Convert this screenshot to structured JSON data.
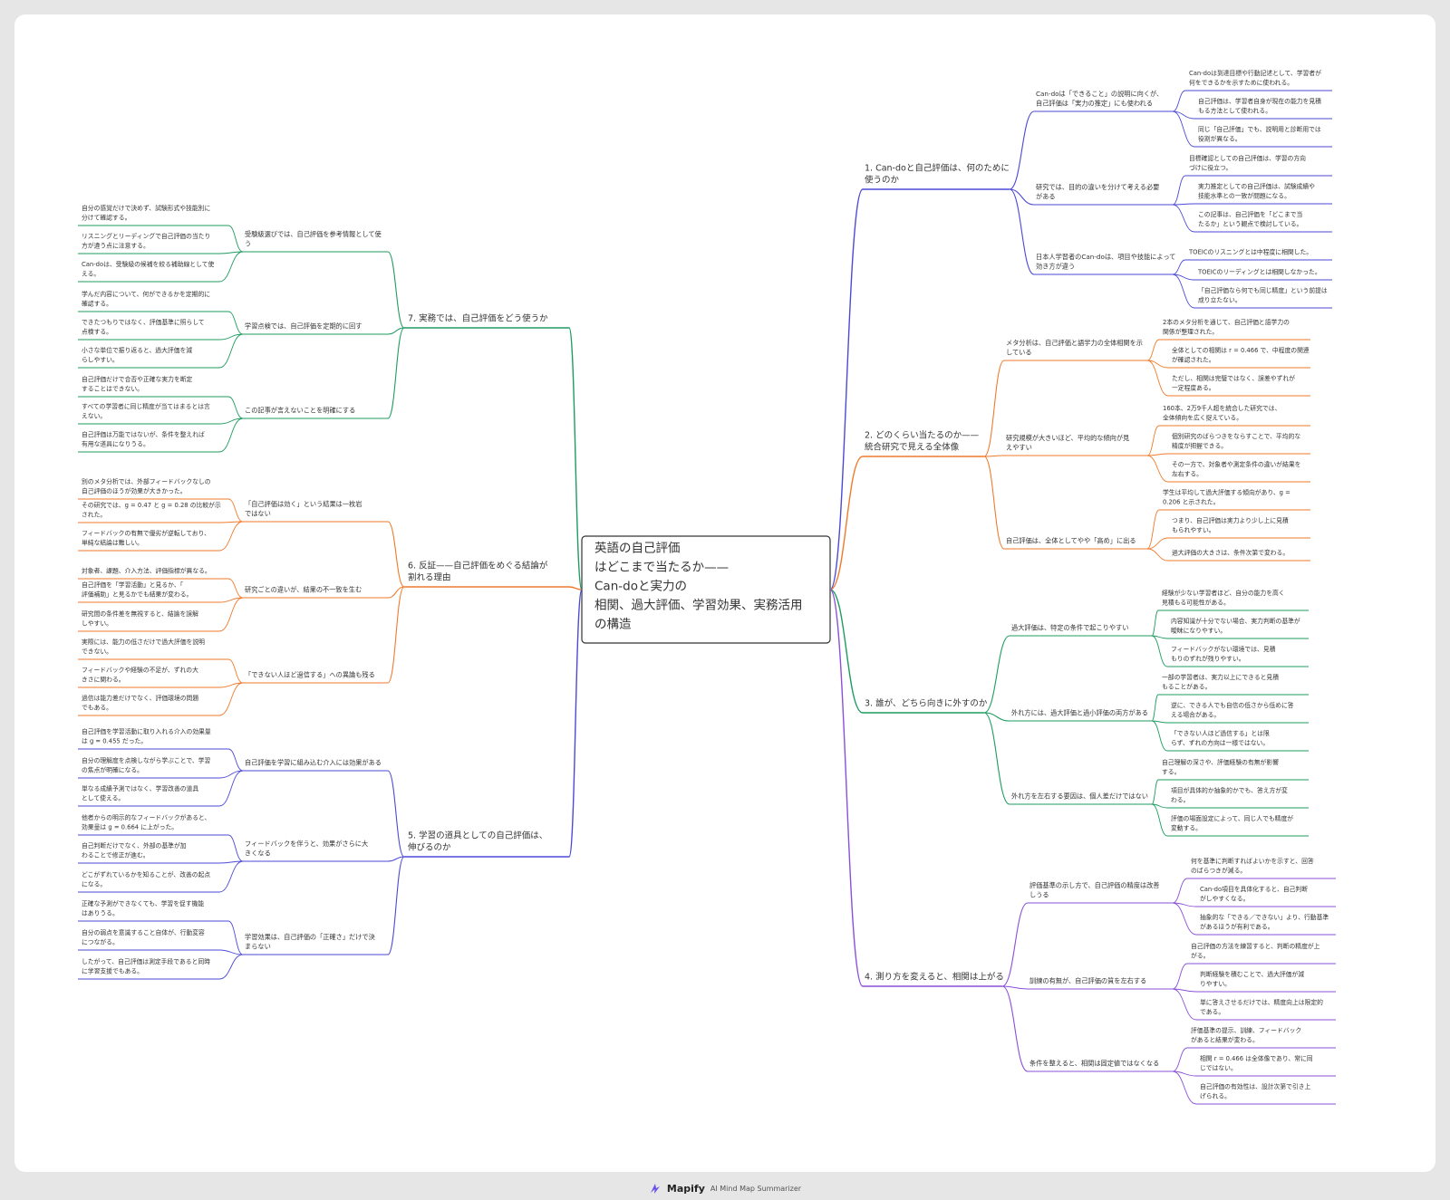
{
  "root": {
    "lines": [
      "英語の自己評価",
      "はどこまで当たるか——",
      "Can-doと実力の",
      "相関、過大評価、学習効果、実務活用",
      "の構造"
    ]
  },
  "footer": {
    "brand": "Mapify",
    "tagline": "AI Mind Map Summarizer"
  },
  "colors": {
    "blue": "#4b49d6",
    "orange": "#f07a2b",
    "green": "#1e9c5f",
    "purple": "#8b4fd8",
    "node_text": "#333333"
  },
  "icons": {
    "footer_logo": "mapify-logo-icon"
  },
  "branches": [
    {
      "id": "b1",
      "side": "right",
      "color": "blue",
      "label": [
        "1. Can-doと自己評価は、何のために",
        "使うのか"
      ],
      "children": [
        {
          "label": [
            "Can-doは「できること」の説明に向くが、",
            "自己評価は「実力の推定」にも使われる"
          ],
          "leaves": [
            [
              "Can-doは到達目標や行動記述として、学習者が",
              "何をできるかを示すために使われる。"
            ],
            [
              "自己評価は、学習者自身が現在の能力を見積",
              "もる方法として使われる。"
            ],
            [
              "同じ「自己評価」でも、説明用と診断用では",
              "役割が異なる。"
            ]
          ]
        },
        {
          "label": [
            "研究では、目的の違いを分けて考える必要",
            "がある"
          ],
          "leaves": [
            [
              "目標確認としての自己評価は、学習の方向",
              "づけに役立つ。"
            ],
            [
              "実力推定としての自己評価は、試験成績や",
              "技能水準との一致が問題になる。"
            ],
            [
              "この記事は、自己評価を「どこまで当",
              "たるか」という観点で検討している。"
            ]
          ]
        },
        {
          "label": [
            "日本人学習者のCan-doは、項目や技能によって",
            "効き方が違う"
          ],
          "leaves": [
            [
              "TOEICのリスニングとは中程度に相関した。"
            ],
            [
              "TOEICのリーディングとは相関しなかった。"
            ],
            [
              "「自己評価なら何でも同じ精度」という前提は",
              "成り立たない。"
            ]
          ]
        }
      ]
    },
    {
      "id": "b2",
      "side": "right",
      "color": "orange",
      "label": [
        "2. どのくらい当たるのか——",
        "統合研究で見える全体像"
      ],
      "children": [
        {
          "label": [
            "メタ分析は、自己評価と語学力の全体相関を示",
            "している"
          ],
          "leaves": [
            [
              "2本のメタ分析を通じて、自己評価と語学力の",
              "関係が整理された。"
            ],
            [
              "全体としての相関は r = 0.466 で、中程度の関連",
              "が確認された。"
            ],
            [
              "ただし、相関は完璧ではなく、誤差やずれが",
              "一定程度ある。"
            ]
          ]
        },
        {
          "label": [
            "研究規模が大きいほど、平均的な傾向が見",
            "えやすい"
          ],
          "leaves": [
            [
              "160本、2万9千人超を統合した研究では、",
              "全体傾向を広く捉えている。"
            ],
            [
              "個別研究のばらつきをならすことで、平均的な",
              "精度が把握できる。"
            ],
            [
              "その一方で、対象者や測定条件の違いが結果を",
              "左右する。"
            ]
          ]
        },
        {
          "label": [
            "自己評価は、全体としてやや「高め」に出る"
          ],
          "leaves": [
            [
              "学生は平均して過大評価する傾向があり、g =",
              "0.206 と示された。"
            ],
            [
              "つまり、自己評価は実力より少し上に見積",
              "もられやすい。"
            ],
            [
              "過大評価の大きさは、条件次第で変わる。"
            ]
          ]
        }
      ]
    },
    {
      "id": "b3",
      "side": "right",
      "color": "green",
      "label": [
        "3. 誰が、どちら向きに外すのか"
      ],
      "children": [
        {
          "label": [
            "過大評価は、特定の条件で起こりやすい"
          ],
          "leaves": [
            [
              "経験が少ない学習者ほど、自分の能力を高く",
              "見積もる可能性がある。"
            ],
            [
              "内容知識が十分でない場合、実力判断の基準が",
              "曖昧になりやすい。"
            ],
            [
              "フィードバックがない環境では、見積",
              "もりのずれが残りやすい。"
            ]
          ]
        },
        {
          "label": [
            "外れ方には、過大評価と過小評価の両方がある"
          ],
          "leaves": [
            [
              "一部の学習者は、実力以上にできると見積",
              "もることがある。"
            ],
            [
              "逆に、できる人でも自信の低さから低めに答",
              "える場合がある。"
            ],
            [
              "「できない人ほど過信する」とは限",
              "らず、ずれの方向は一様ではない。"
            ]
          ]
        },
        {
          "label": [
            "外れ方を左右する要因は、個人差だけではない"
          ],
          "leaves": [
            [
              "自己理解の深さや、評価経験の有無が影響",
              "する。"
            ],
            [
              "項目が具体的か抽象的かでも、答え方が変",
              "わる。"
            ],
            [
              "評価の場面設定によって、同じ人でも精度が",
              "変動する。"
            ]
          ]
        }
      ]
    },
    {
      "id": "b4",
      "side": "right",
      "color": "purple",
      "label": [
        "4. 測り方を変えると、相関は上がる"
      ],
      "children": [
        {
          "label": [
            "評価基準の示し方で、自己評価の精度は改善",
            "しうる"
          ],
          "leaves": [
            [
              "何を基準に判断すればよいかを示すと、回答",
              "のばらつきが減る。"
            ],
            [
              "Can-do項目を具体化すると、自己判断",
              "がしやすくなる。"
            ],
            [
              "抽象的な「できる／できない」より、行動基準",
              "があるほうが有利である。"
            ]
          ]
        },
        {
          "label": [
            "訓練の有無が、自己評価の質を左右する"
          ],
          "leaves": [
            [
              "自己評価の方法を練習すると、判断の精度が上",
              "がる。"
            ],
            [
              "判断経験を積むことで、過大評価が減",
              "りやすい。"
            ],
            [
              "単に答えさせるだけでは、精度向上は限定的",
              "である。"
            ]
          ]
        },
        {
          "label": [
            "条件を整えると、相関は固定値ではなくなる"
          ],
          "leaves": [
            [
              "評価基準の提示、訓練、フィードバック",
              "があると結果が変わる。"
            ],
            [
              "相関 r = 0.466 は全体像であり、常に同",
              "じではない。"
            ],
            [
              "自己評価の有効性は、設計次第で引き上",
              "げられる。"
            ]
          ]
        }
      ]
    },
    {
      "id": "b7",
      "side": "left",
      "color": "green",
      "label": [
        "7. 実務では、自己評価をどう使うか"
      ],
      "children": [
        {
          "label": [
            "受験級選びでは、自己評価を参考情報として使",
            "う"
          ],
          "leaves": [
            [
              "自分の感覚だけで決めず、試験形式や技能別に",
              "分けて確認する。"
            ],
            [
              "リスニングとリーディングで自己評価の当たり",
              "方が違う点に注意する。"
            ],
            [
              "Can-doは、受験級の候補を絞る補助線として使",
              "える。"
            ]
          ]
        },
        {
          "label": [
            "学習点検では、自己評価を定期的に回す"
          ],
          "leaves": [
            [
              "学んだ内容について、何ができるかを定期的に",
              "確認する。"
            ],
            [
              "できたつもりではなく、評価基準に照らして",
              "点検する。"
            ],
            [
              "小さな単位で振り返ると、過大評価を減",
              "らしやすい。"
            ]
          ]
        },
        {
          "label": [
            "この記事が言えないことを明確にする"
          ],
          "leaves": [
            [
              "自己評価だけで合否や正確な実力を断定",
              "することはできない。"
            ],
            [
              "すべての学習者に同じ精度が当てはまるとは言",
              "えない。"
            ],
            [
              "自己評価は万能ではないが、条件を整えれば",
              "有用な道具になりうる。"
            ]
          ]
        }
      ]
    },
    {
      "id": "b6",
      "side": "left",
      "color": "orange",
      "label": [
        "6. 反証——自己評価をめぐる結論が",
        "割れる理由"
      ],
      "children": [
        {
          "label": [
            "「自己評価は効く」という結果は一枚岩",
            "ではない"
          ],
          "leaves": [
            [
              "別のメタ分析では、外部フィードバックなしの",
              "自己評価のほうが効果が大きかった。"
            ],
            [
              "その研究では、g = 0.47 と g = 0.28 の比較が示",
              "された。"
            ],
            [
              "フィードバックの有無で優劣が逆転しており、",
              "単純な結論は難しい。"
            ]
          ]
        },
        {
          "label": [
            "研究ごとの違いが、結果の不一致を生む"
          ],
          "leaves": [
            [
              "対象者、課題、介入方法、評価指標が異なる。"
            ],
            [
              "自己評価を「学習活動」と見るか、「",
              "評価補助」と見るかでも結果が変わる。"
            ],
            [
              "研究間の条件差を無視すると、結論を誤解",
              "しやすい。"
            ]
          ]
        },
        {
          "label": [
            "「できない人ほど過信する」への異論も残る"
          ],
          "leaves": [
            [
              "実際には、能力の低さだけで過大評価を説明",
              "できない。"
            ],
            [
              "フィードバックや経験の不足が、ずれの大",
              "きさに関わる。"
            ],
            [
              "過信は能力差だけでなく、評価環境の問題",
              "でもある。"
            ]
          ]
        }
      ]
    },
    {
      "id": "b5",
      "side": "left",
      "color": "blue",
      "label": [
        "5. 学習の道具としての自己評価は、",
        "伸びるのか"
      ],
      "children": [
        {
          "label": [
            "自己評価を学習に組み込む介入には効果がある"
          ],
          "leaves": [
            [
              "自己評価を学習活動に取り入れる介入の効果量",
              "は g = 0.455 だった。"
            ],
            [
              "自分の理解度を点検しながら学ぶことで、学習",
              "の焦点が明確になる。"
            ],
            [
              "単なる成績予測ではなく、学習改善の道具",
              "として使える。"
            ]
          ]
        },
        {
          "label": [
            "フィードバックを伴うと、効果がさらに大",
            "きくなる"
          ],
          "leaves": [
            [
              "他者からの明示的なフィードバックがあると、",
              "効果量は g = 0.664 に上がった。"
            ],
            [
              "自己判断だけでなく、外部の基準が加",
              "わることで修正が進む。"
            ],
            [
              "どこがずれているかを知ることが、改善の起点",
              "になる。"
            ]
          ]
        },
        {
          "label": [
            "学習効果は、自己評価の「正確さ」だけで決",
            "まらない"
          ],
          "leaves": [
            [
              "正確な予測ができなくても、学習を促す機能",
              "はありうる。"
            ],
            [
              "自分の弱点を意識すること自体が、行動変容",
              "につながる。"
            ],
            [
              "したがって、自己評価は測定手段であると同時",
              "に学習支援でもある。"
            ]
          ]
        }
      ]
    }
  ]
}
